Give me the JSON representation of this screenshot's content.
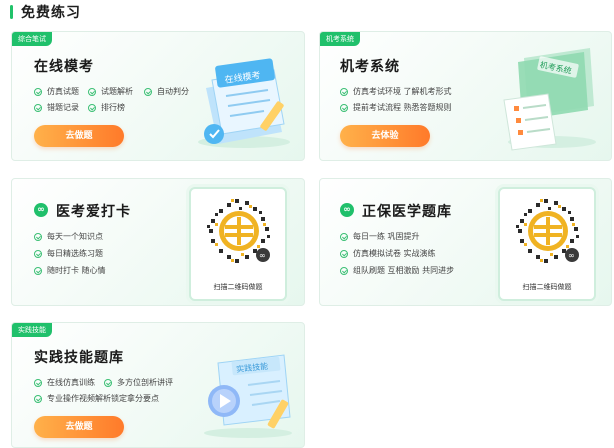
{
  "section": {
    "title": "免费练习"
  },
  "cards": {
    "online_exam": {
      "tag": "综合笔试",
      "title": "在线模考",
      "features": [
        "仿真试题",
        "试题解析",
        "自动判分",
        "错题记录",
        "排行榜"
      ],
      "button": "去做题",
      "illustration_text": "在线模考"
    },
    "computer_exam": {
      "tag": "机考系统",
      "title": "机考系统",
      "features": [
        "仿真考试环境 了解机考形式",
        "提前考试流程 熟悉答题规则"
      ],
      "button": "去体验",
      "illustration_text": "机考系统"
    },
    "checkin": {
      "title": "医考爱打卡",
      "features": [
        "每天一个知识点",
        "每日精选练习题",
        "随时打卡 随心情"
      ],
      "qr_caption": "扫描二维码做题"
    },
    "insurance": {
      "title": "正保医学题库",
      "features": [
        "每日一练 巩固提升",
        "仿真模拟试卷 实战演练",
        "组队刷题 互相激励 共同进步"
      ],
      "qr_caption": "扫描二维码做题"
    },
    "practice": {
      "tag": "实践技能",
      "title": "实践技能题库",
      "features": [
        "在线仿真训练",
        "多方位剖析讲评",
        "专业操作视频解析锁定拿分要点"
      ],
      "button": "去做题",
      "illustration_text": "实践技能"
    }
  },
  "colors": {
    "accent_green": "#20c06b",
    "button_orange": "#ff8a30"
  }
}
